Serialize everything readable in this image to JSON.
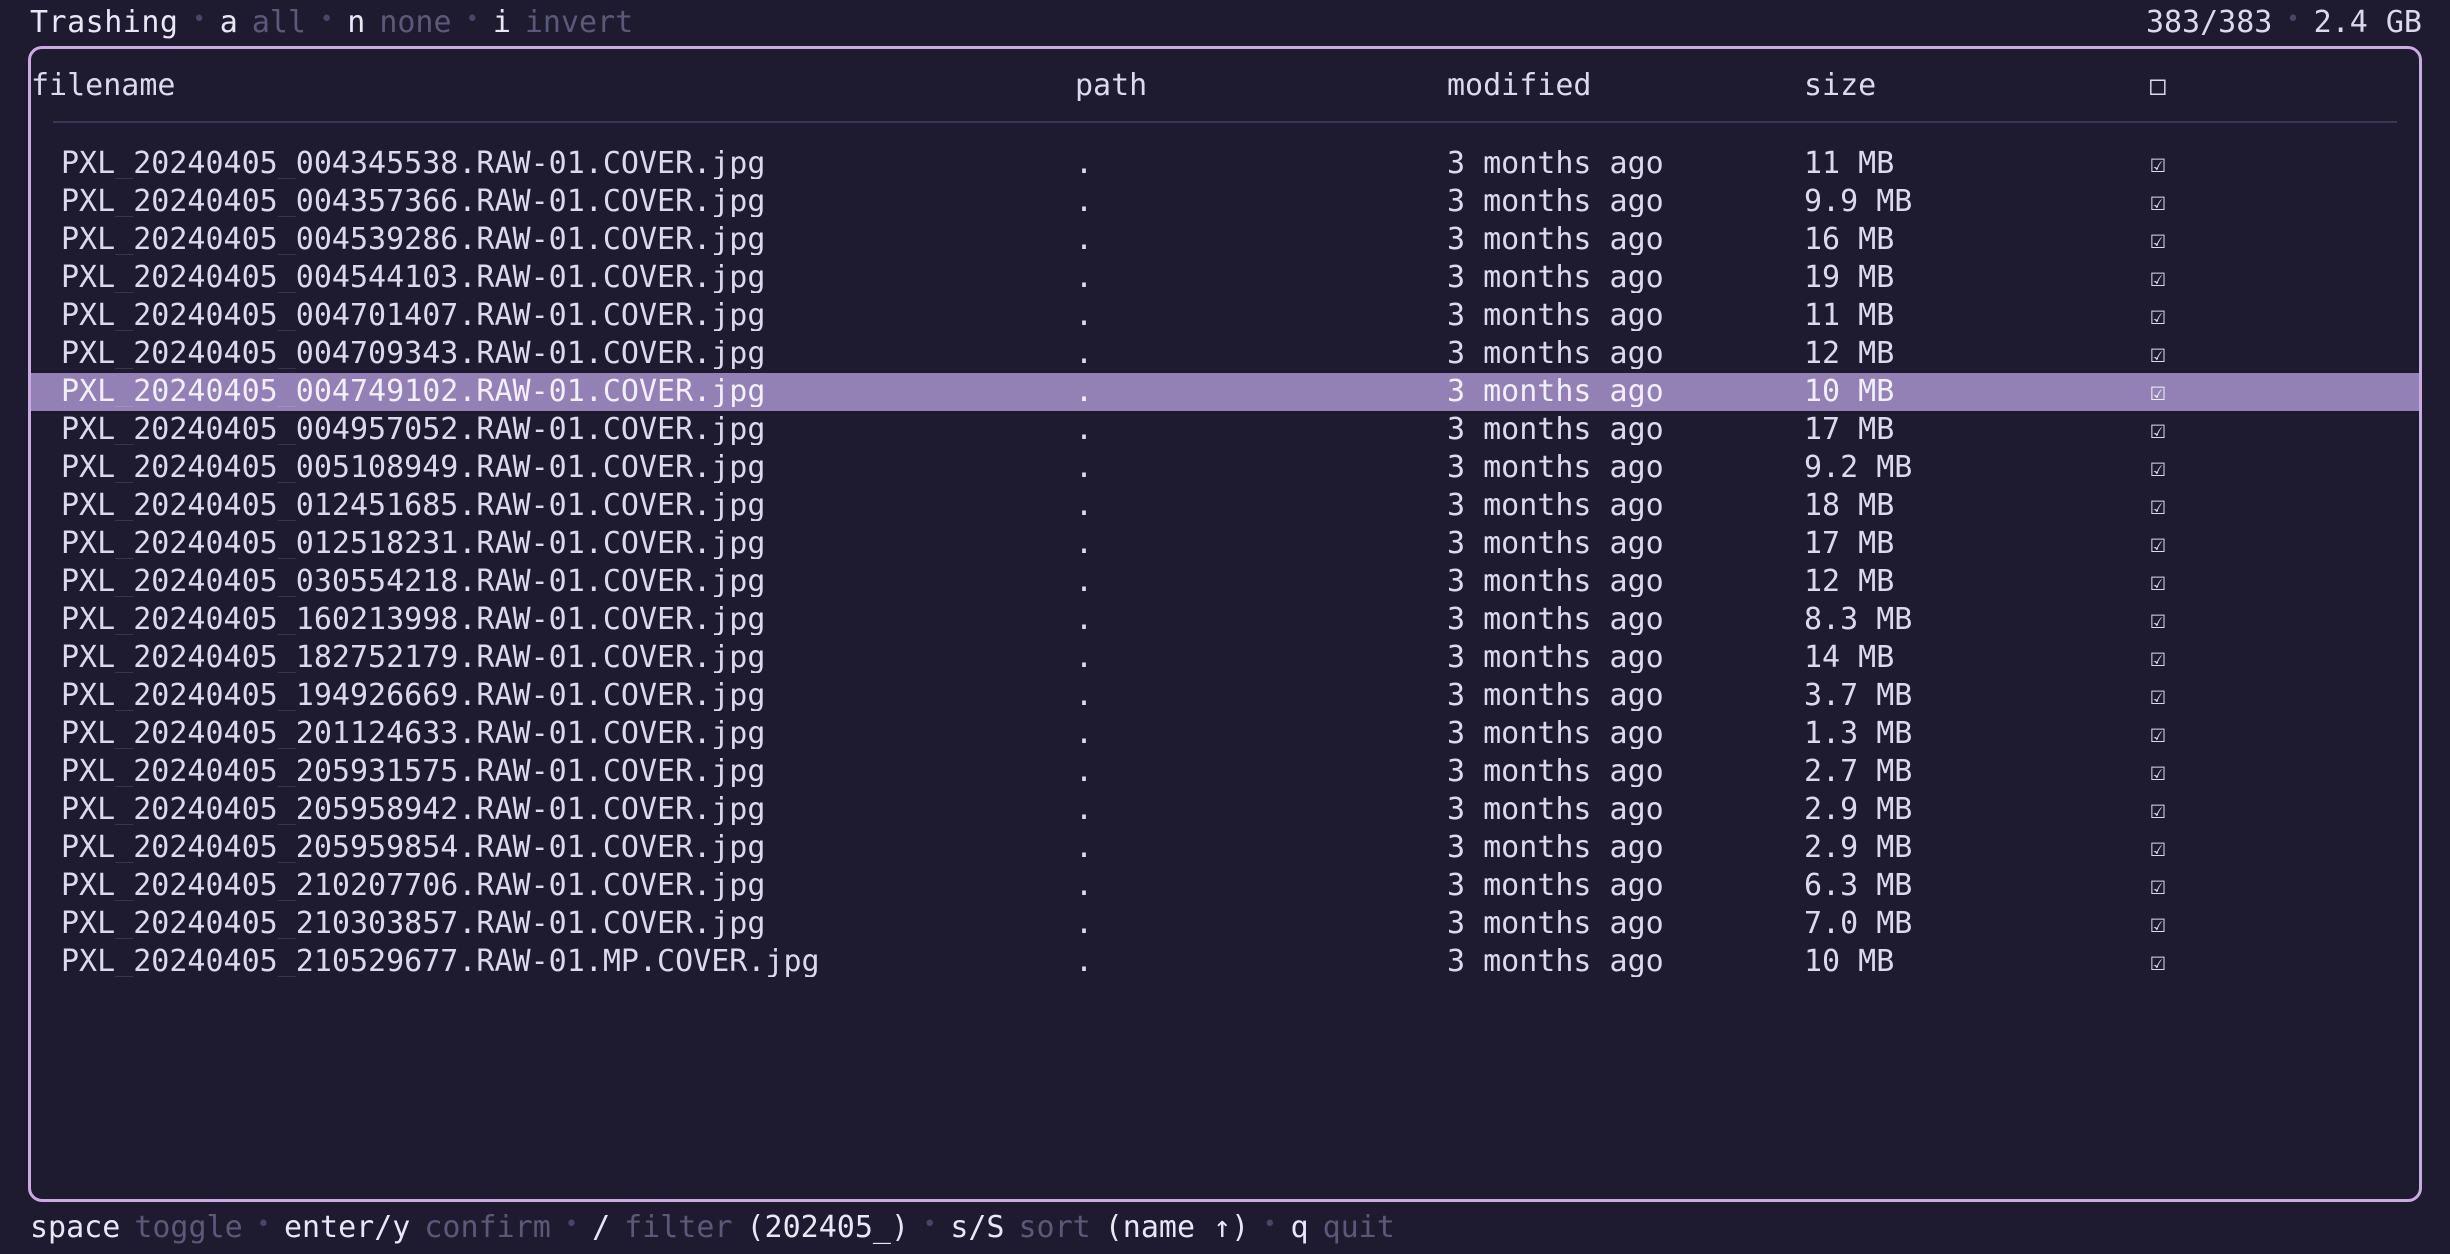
{
  "topbar": {
    "title": "Trashing",
    "bullet": "•",
    "actions": [
      {
        "key": "a",
        "label": "all"
      },
      {
        "key": "n",
        "label": "none"
      },
      {
        "key": "i",
        "label": "invert"
      }
    ],
    "count": "383/383",
    "total_size": "2.4 GB"
  },
  "table": {
    "columns": {
      "filename": "filename",
      "path": "path",
      "modified": "modified",
      "size": "size",
      "select_all_icon": "□"
    },
    "checked_glyph": "☑",
    "rows": [
      {
        "filename": "PXL_20240405_004345538.RAW-01.COVER.jpg",
        "path": ".",
        "modified": "3 months ago",
        "size": "11 MB",
        "checked": "☑",
        "selected": false
      },
      {
        "filename": "PXL_20240405_004357366.RAW-01.COVER.jpg",
        "path": ".",
        "modified": "3 months ago",
        "size": "9.9 MB",
        "checked": "☑",
        "selected": false
      },
      {
        "filename": "PXL_20240405_004539286.RAW-01.COVER.jpg",
        "path": ".",
        "modified": "3 months ago",
        "size": "16 MB",
        "checked": "☑",
        "selected": false
      },
      {
        "filename": "PXL_20240405_004544103.RAW-01.COVER.jpg",
        "path": ".",
        "modified": "3 months ago",
        "size": "19 MB",
        "checked": "☑",
        "selected": false
      },
      {
        "filename": "PXL_20240405_004701407.RAW-01.COVER.jpg",
        "path": ".",
        "modified": "3 months ago",
        "size": "11 MB",
        "checked": "☑",
        "selected": false
      },
      {
        "filename": "PXL_20240405_004709343.RAW-01.COVER.jpg",
        "path": ".",
        "modified": "3 months ago",
        "size": "12 MB",
        "checked": "☑",
        "selected": false
      },
      {
        "filename": "PXL_20240405_004749102.RAW-01.COVER.jpg",
        "path": ".",
        "modified": "3 months ago",
        "size": "10 MB",
        "checked": "☑",
        "selected": true
      },
      {
        "filename": "PXL_20240405_004957052.RAW-01.COVER.jpg",
        "path": ".",
        "modified": "3 months ago",
        "size": "17 MB",
        "checked": "☑",
        "selected": false
      },
      {
        "filename": "PXL_20240405_005108949.RAW-01.COVER.jpg",
        "path": ".",
        "modified": "3 months ago",
        "size": "9.2 MB",
        "checked": "☑",
        "selected": false
      },
      {
        "filename": "PXL_20240405_012451685.RAW-01.COVER.jpg",
        "path": ".",
        "modified": "3 months ago",
        "size": "18 MB",
        "checked": "☑",
        "selected": false
      },
      {
        "filename": "PXL_20240405_012518231.RAW-01.COVER.jpg",
        "path": ".",
        "modified": "3 months ago",
        "size": "17 MB",
        "checked": "☑",
        "selected": false
      },
      {
        "filename": "PXL_20240405_030554218.RAW-01.COVER.jpg",
        "path": ".",
        "modified": "3 months ago",
        "size": "12 MB",
        "checked": "☑",
        "selected": false
      },
      {
        "filename": "PXL_20240405_160213998.RAW-01.COVER.jpg",
        "path": ".",
        "modified": "3 months ago",
        "size": "8.3 MB",
        "checked": "☑",
        "selected": false
      },
      {
        "filename": "PXL_20240405_182752179.RAW-01.COVER.jpg",
        "path": ".",
        "modified": "3 months ago",
        "size": "14 MB",
        "checked": "☑",
        "selected": false
      },
      {
        "filename": "PXL_20240405_194926669.RAW-01.COVER.jpg",
        "path": ".",
        "modified": "3 months ago",
        "size": "3.7 MB",
        "checked": "☑",
        "selected": false
      },
      {
        "filename": "PXL_20240405_201124633.RAW-01.COVER.jpg",
        "path": ".",
        "modified": "3 months ago",
        "size": "1.3 MB",
        "checked": "☑",
        "selected": false
      },
      {
        "filename": "PXL_20240405_205931575.RAW-01.COVER.jpg",
        "path": ".",
        "modified": "3 months ago",
        "size": "2.7 MB",
        "checked": "☑",
        "selected": false
      },
      {
        "filename": "PXL_20240405_205958942.RAW-01.COVER.jpg",
        "path": ".",
        "modified": "3 months ago",
        "size": "2.9 MB",
        "checked": "☑",
        "selected": false
      },
      {
        "filename": "PXL_20240405_205959854.RAW-01.COVER.jpg",
        "path": ".",
        "modified": "3 months ago",
        "size": "2.9 MB",
        "checked": "☑",
        "selected": false
      },
      {
        "filename": "PXL_20240405_210207706.RAW-01.COVER.jpg",
        "path": ".",
        "modified": "3 months ago",
        "size": "6.3 MB",
        "checked": "☑",
        "selected": false
      },
      {
        "filename": "PXL_20240405_210303857.RAW-01.COVER.jpg",
        "path": ".",
        "modified": "3 months ago",
        "size": "7.0 MB",
        "checked": "☑",
        "selected": false
      },
      {
        "filename": "PXL_20240405_210529677.RAW-01.MP.COVER.jpg",
        "path": ".",
        "modified": "3 months ago",
        "size": "10 MB",
        "checked": "☑",
        "selected": false
      }
    ]
  },
  "footer": {
    "bullet": "•",
    "items": [
      {
        "key": "space",
        "label": "toggle",
        "value": ""
      },
      {
        "key": "enter/y",
        "label": "confirm",
        "value": ""
      },
      {
        "key": "/",
        "label": "filter",
        "value": "(202405_)"
      },
      {
        "key": "s/S",
        "label": "sort",
        "value": "(name ↑)"
      },
      {
        "key": "q",
        "label": "quit",
        "value": ""
      }
    ]
  },
  "colors": {
    "background": "#1e1b30",
    "border": "#c9abe0",
    "selection": "#9380b4",
    "text": "#dcd9ef",
    "dim": "#5c5878"
  }
}
